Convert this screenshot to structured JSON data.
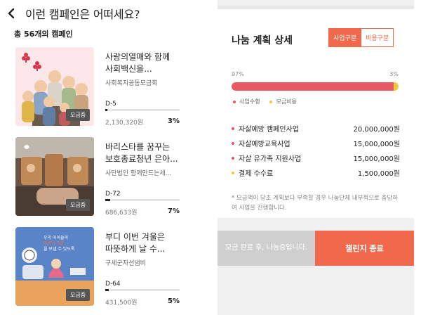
{
  "header": {
    "title": "이런 캠페인은 어떠세요?"
  },
  "list": {
    "count_label": "총 56개의 캠페인"
  },
  "campaigns": [
    {
      "title_line1": "사랑의열매와 함께",
      "title_line2": "사회백신을...",
      "org": "사회복지공동모금회",
      "badge": "모금중",
      "dday": "D-5",
      "amount": "2,130,320원",
      "percent": "3%",
      "progress": 0.03
    },
    {
      "title_line1": "바리스타를 꿈꾸는",
      "title_line2": "보호종료청년 은아...",
      "org": "사단법인 함께만드는세...",
      "badge": "모금중",
      "dday": "D-72",
      "amount": "686,633원",
      "percent": "7%",
      "progress": 0.07
    },
    {
      "title_line1": "부디 이번 겨울은",
      "title_line2": "따뜻하게 날 수...",
      "org": "구세군자선냄비",
      "badge": "모금중",
      "dday": "D-64",
      "amount": "431,500원",
      "percent": "5%",
      "progress": 0.05
    }
  ],
  "thumb3_text": {
    "line1": "우리 아이들의",
    "line2": "따뜻한 겨울",
    "line3": "을 보낼 수 있도록"
  },
  "detail": {
    "title": "나눔 계획 상세",
    "toggle": {
      "on": "사업구분",
      "off": "비용구분"
    },
    "left_pct": "97%",
    "right_pct": "3%",
    "business_ratio": 0.97,
    "legend": [
      {
        "label": "사업수행",
        "color": "#e85a63"
      },
      {
        "label": "모금비용",
        "color": "#f0c93a"
      }
    ],
    "plans": [
      {
        "label": "자살예방 캠페인사업",
        "amount": "20,000,000원",
        "color": "#e85a63"
      },
      {
        "label": "자살예방교육사업",
        "amount": "15,000,000원",
        "color": "#e85a63"
      },
      {
        "label": "자살 유가족 지원사업",
        "amount": "15,000,000원",
        "color": "#e85a63"
      },
      {
        "label": "결제 수수료",
        "amount": "1,500,000원",
        "color": "#f0c93a"
      }
    ],
    "note": "* 모금액이 당초 계획보다 부족할 경우 나눔단체 내부적으로 충당하여 사업을 진행합니다."
  },
  "bottom": {
    "gray_text": "모금 완료 후, 나눔중입니다.",
    "orange_text": "챌린지 종료"
  },
  "colors": {
    "accent": "#f0694c",
    "business": "#e85a63",
    "fee": "#f0c93a"
  }
}
